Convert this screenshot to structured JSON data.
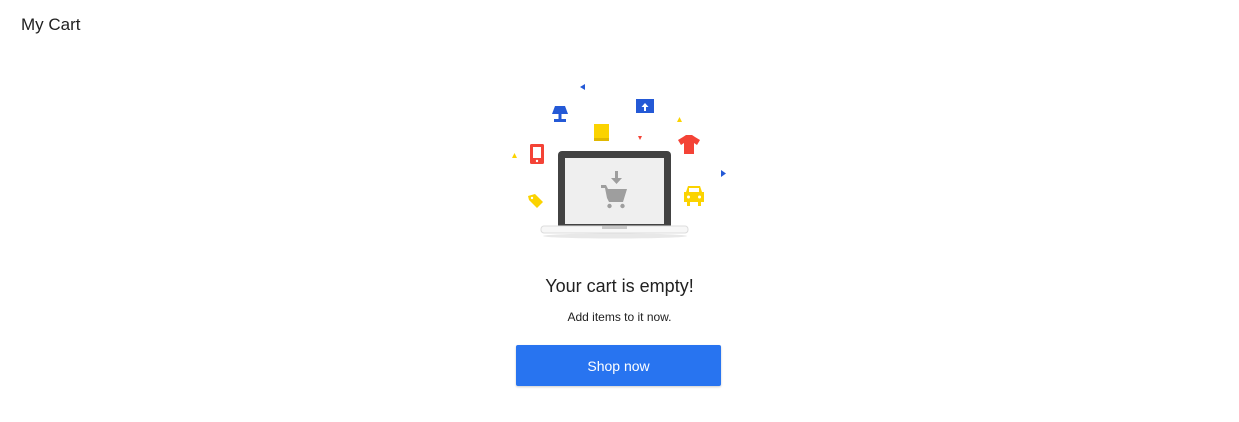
{
  "header": {
    "title": "My Cart"
  },
  "empty_state": {
    "heading": "Your cart is empty!",
    "subtext": "Add items to it now.",
    "cta_label": "Shop now",
    "illustration_icons": [
      "laptop-icon",
      "cart-download-icon",
      "lamp-icon",
      "book-icon",
      "monitor-icon",
      "shirt-icon",
      "phone-icon",
      "tag-icon",
      "car-icon"
    ]
  },
  "colors": {
    "accent_blue": "#2874f0",
    "red": "#f44336",
    "yellow": "#fbd300",
    "dark_blue": "#2459d6",
    "text": "#212121"
  }
}
